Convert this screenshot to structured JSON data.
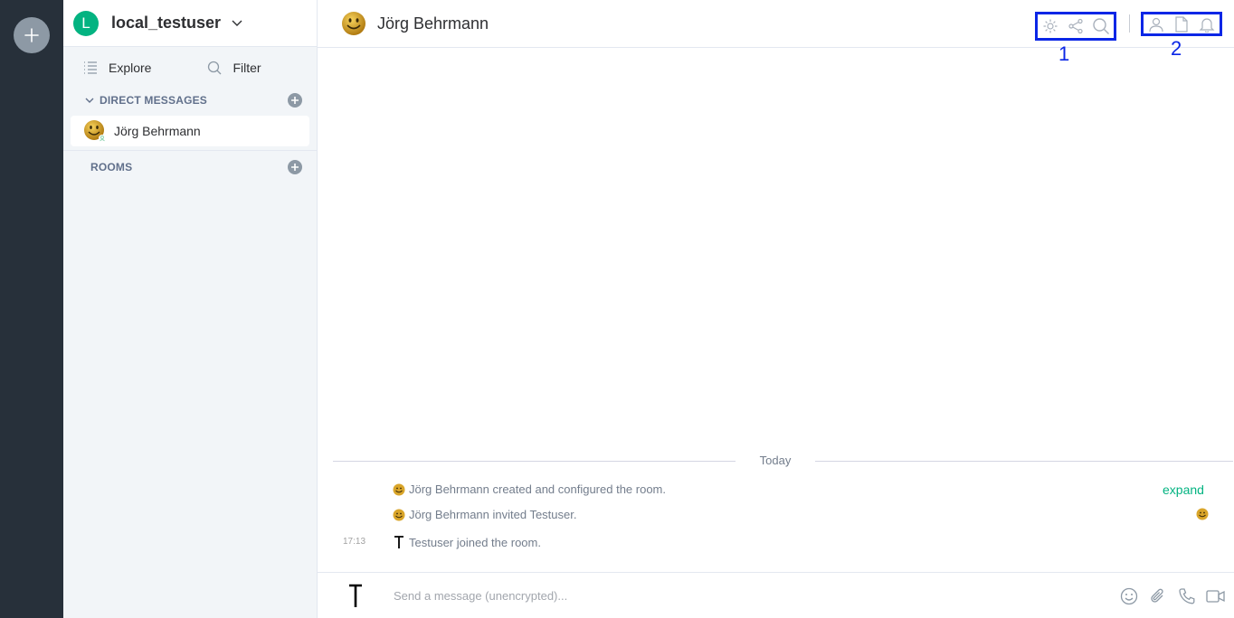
{
  "app": {
    "user": {
      "initial": "L",
      "name": "local_testuser"
    },
    "sidebar": {
      "explore_label": "Explore",
      "filter_label": "Filter",
      "sections": {
        "direct_messages": {
          "title": "DIRECT MESSAGES"
        },
        "rooms": {
          "title": "ROOMS"
        }
      },
      "dm_items": [
        {
          "name": "Jörg Behrmann"
        }
      ]
    },
    "room": {
      "name": "Jörg Behrmann",
      "header_group_labels": {
        "group1": "1",
        "group2": "2"
      },
      "date_separator": "Today",
      "events": [
        {
          "text": "Jörg Behrmann created and configured the room."
        },
        {
          "text": "Jörg Behrmann invited Testuser."
        },
        {
          "text": "Testuser joined the room.",
          "time": "17:13"
        }
      ],
      "expand_label": "expand",
      "composer": {
        "placeholder": "Send a message (unencrypted)..."
      }
    },
    "colors": {
      "accent": "#03b381",
      "rail": "#27303a",
      "annotation_blue": "#0a26e6"
    }
  }
}
